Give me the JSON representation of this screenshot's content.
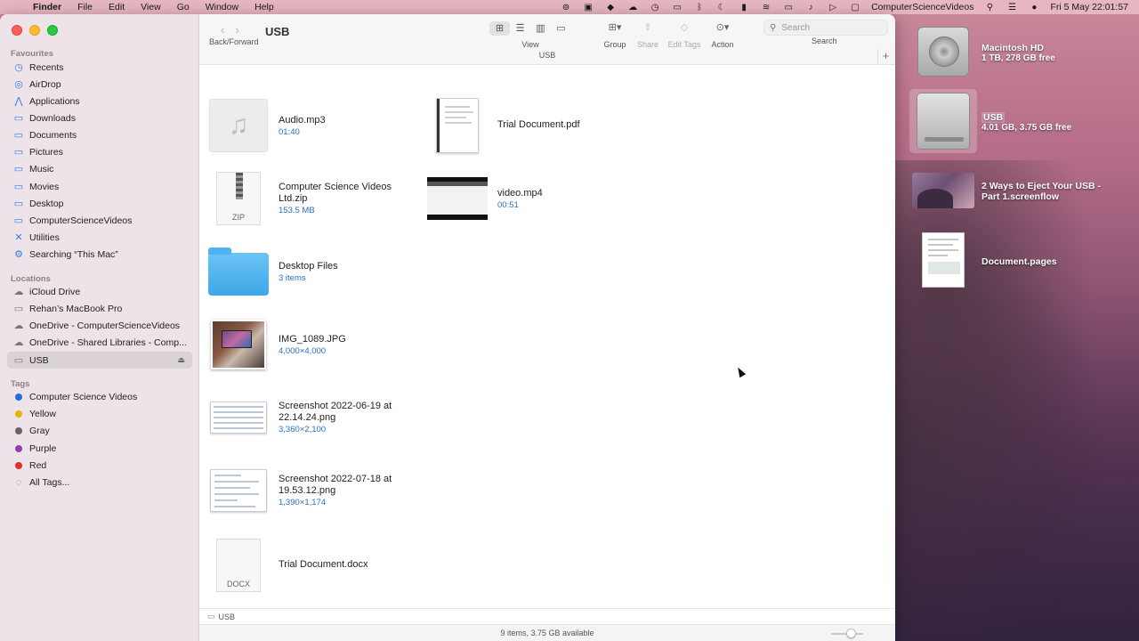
{
  "menubar": {
    "items": [
      "Finder",
      "File",
      "Edit",
      "View",
      "Go",
      "Window",
      "Help"
    ],
    "status_user": "ComputerScienceVideos",
    "clock": "Fri 5 May  22:01:57"
  },
  "window": {
    "title": "USB",
    "nav_label": "Back/Forward",
    "toolbar": {
      "view": "View",
      "group": "Group",
      "share": "Share",
      "edit_tags": "Edit Tags",
      "action": "Action",
      "search_placeholder": "Search",
      "search_label": "Search"
    },
    "tab_title": "USB"
  },
  "sidebar": {
    "favourites_label": "Favourites",
    "favourites": [
      {
        "label": "Recents",
        "icon": "clock-icon"
      },
      {
        "label": "AirDrop",
        "icon": "airdrop-icon"
      },
      {
        "label": "Applications",
        "icon": "applications-icon"
      },
      {
        "label": "Downloads",
        "icon": "folder-icon"
      },
      {
        "label": "Documents",
        "icon": "folder-icon"
      },
      {
        "label": "Pictures",
        "icon": "folder-icon"
      },
      {
        "label": "Music",
        "icon": "folder-icon"
      },
      {
        "label": "Movies",
        "icon": "folder-icon"
      },
      {
        "label": "Desktop",
        "icon": "folder-icon"
      },
      {
        "label": "ComputerScienceVideos",
        "icon": "folder-icon"
      },
      {
        "label": "Utilities",
        "icon": "utilities-icon"
      },
      {
        "label": "Searching “This Mac”",
        "icon": "smart-folder-icon"
      }
    ],
    "locations_label": "Locations",
    "locations": [
      {
        "label": "iCloud Drive",
        "icon": "cloud-icon"
      },
      {
        "label": "Rehan’s MacBook Pro",
        "icon": "laptop-icon"
      },
      {
        "label": "OneDrive - ComputerScienceVideos",
        "icon": "cloud-icon"
      },
      {
        "label": "OneDrive - Shared Libraries - Comp...",
        "icon": "cloud-icon"
      },
      {
        "label": "USB",
        "icon": "drive-icon"
      }
    ],
    "tags_label": "Tags",
    "tags": [
      {
        "label": "Computer Science Videos",
        "color": "#1f6fe0"
      },
      {
        "label": "Yellow",
        "color": "#e8b400"
      },
      {
        "label": "Gray",
        "color": "#666666"
      },
      {
        "label": "Purple",
        "color": "#8e3fb5"
      },
      {
        "label": "Red",
        "color": "#e0302a"
      },
      {
        "label": "All Tags...",
        "color": ""
      }
    ]
  },
  "files": [
    {
      "name": "Audio.mp3",
      "meta": "01:40",
      "kind": "audio"
    },
    {
      "name": "Trial Document.pdf",
      "meta": "",
      "kind": "pdf"
    },
    {
      "name": "Computer Science Videos Ltd.zip",
      "meta": "153.5 MB",
      "kind": "zip",
      "badge": "ZIP"
    },
    {
      "name": "video.mp4",
      "meta": "00:51",
      "kind": "video"
    },
    {
      "name": "Desktop Files",
      "meta": "3 items",
      "kind": "folder"
    },
    {
      "name": "IMG_1089.JPG",
      "meta": "4,000×4,000",
      "kind": "photo"
    },
    {
      "name": "Screenshot 2022-06-19 at 22.14.24.png",
      "meta": "3,360×2,100",
      "kind": "screenshot"
    },
    {
      "name": "Screenshot 2022-07-18 at 19.53.12.png",
      "meta": "1,390×1,174",
      "kind": "screenshot"
    },
    {
      "name": "Trial Document.docx",
      "meta": "",
      "kind": "docx",
      "badge": "DOCX"
    }
  ],
  "pathbar": {
    "label": "USB"
  },
  "statusbar": {
    "text": "9 items, 3.75 GB available"
  },
  "desktop": [
    {
      "name": "Macintosh HD",
      "sub": "1 TB, 278 GB free",
      "kind": "hd"
    },
    {
      "name": "USB",
      "sub": "4.01 GB, 3.75 GB free",
      "kind": "usb"
    },
    {
      "name": "2 Ways to Eject Your USB - Part 1.screenflow",
      "sub": "",
      "kind": "screenflow"
    },
    {
      "name": "Document.pages",
      "sub": "",
      "kind": "pages"
    }
  ]
}
